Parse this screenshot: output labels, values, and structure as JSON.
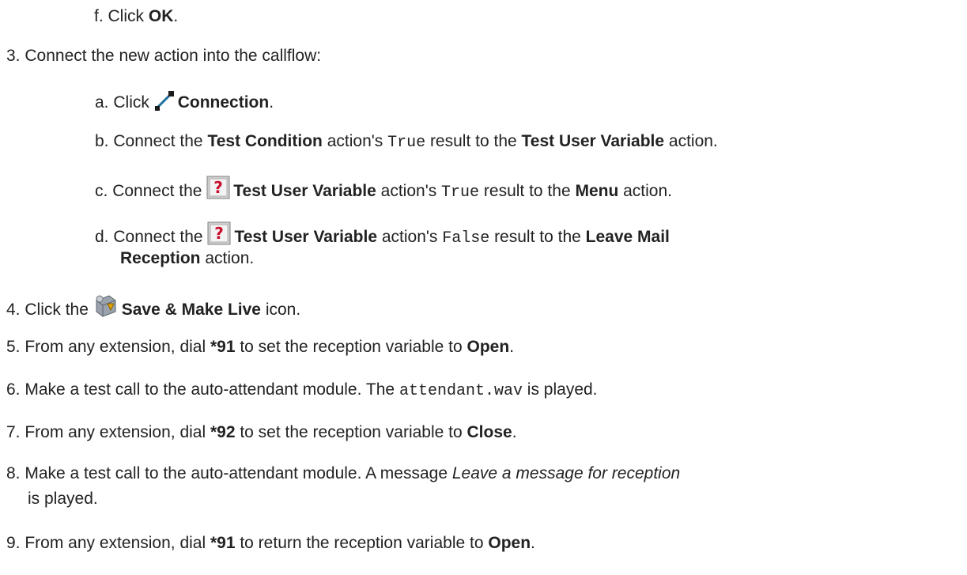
{
  "steps": {
    "f": {
      "marker": "f.",
      "text": "Click ",
      "b1": "OK",
      "end": "."
    },
    "s3": {
      "marker": "3.",
      "text": "Connect the new action into the callflow:"
    },
    "a": {
      "marker": "a.",
      "text": "Click ",
      "icon": "connection-icon",
      "b1": "Connection",
      "end": "."
    },
    "b": {
      "marker": "b.",
      "t1": "Connect the ",
      "b1": "Test Condition",
      "t2": " action's ",
      "m1": "True",
      "t3": " result to the ",
      "b2": "Test User Variable",
      "t4": " action."
    },
    "c": {
      "marker": "c.",
      "t1": "Connect the ",
      "icon": "test-user-variable-icon",
      "b1": "Test User Variable",
      "t2": " action's ",
      "m1": "True",
      "t3": " result to the ",
      "b2": "Menu",
      "t4": " action."
    },
    "d": {
      "marker": "d.",
      "t1": "Connect the ",
      "icon": "test-user-variable-icon",
      "b1": "Test User Variable",
      "t2": " action's ",
      "m1": "False",
      "t3": " result to the ",
      "b2": "Leave Mail",
      "b3": "Reception",
      "t4": " action."
    },
    "s4": {
      "marker": "4.",
      "t1": "Click the ",
      "icon": "save-make-live-icon",
      "b1": "Save & Make Live",
      "t2": " icon."
    },
    "s5": {
      "marker": "5.",
      "t1": "From any extension, dial ",
      "b1": "*91",
      "t2": " to set the reception variable to ",
      "b2": "Open",
      "t3": "."
    },
    "s6": {
      "marker": "6.",
      "t1": "Make a test call to the auto-attendant module. The ",
      "m1": "attendant.wav",
      "t2": " is played."
    },
    "s7": {
      "marker": "7.",
      "t1": "From any extension, dial ",
      "b1": "*92",
      "t2": " to set the reception variable to ",
      "b2": "Close",
      "t3": "."
    },
    "s8": {
      "marker": "8.",
      "t1": "Make a test call to the auto-attendant module. A message ",
      "i1": "Leave a message for reception",
      "t2": "is played."
    },
    "s9": {
      "marker": "9.",
      "t1": "From any extension, dial ",
      "b1": "*91",
      "t2": " to return the reception variable to ",
      "b2": "Open",
      "t3": "."
    }
  }
}
